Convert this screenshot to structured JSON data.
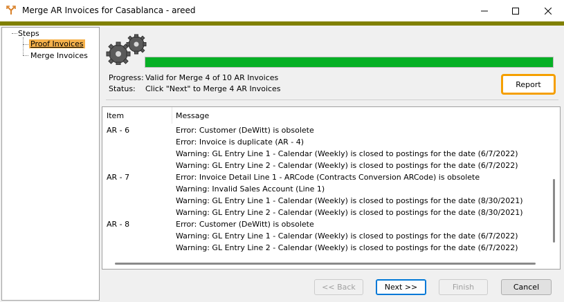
{
  "window": {
    "title": "Merge AR Invoices for Casablanca - areed",
    "icons": {
      "app": "merge-arrow-icon",
      "minimize": "minimize-icon",
      "maximize": "maximize-icon",
      "close": "close-icon"
    },
    "accent_bar_color": "#808000"
  },
  "tree": {
    "root_label": "Steps",
    "items": [
      {
        "label": "Proof Invoices",
        "selected": true
      },
      {
        "label": "Merge Invoices",
        "selected": false
      }
    ],
    "selected_color": "#f6b24b"
  },
  "progress": {
    "icon": "gears-icon",
    "fraction": 1.0,
    "bar_color": "#06b025",
    "progress_label": "Progress:",
    "progress_text": "Valid for Merge 4 of 10 AR Invoices",
    "status_label": "Status:",
    "status_text": "Click \"Next\" to Merge 4 AR Invoices"
  },
  "report_button": {
    "label": "Report",
    "highlight_color": "#f59f00"
  },
  "grid": {
    "columns": [
      "Item",
      "Message"
    ],
    "rows": [
      {
        "item": "AR - 6",
        "message": "Error: Customer (DeWitt) is obsolete"
      },
      {
        "item": "",
        "message": "Error: Invoice is duplicate (AR - 4)"
      },
      {
        "item": "",
        "message": "Warning: GL Entry Line 1 - Calendar (Weekly) is closed to postings for the date (6/7/2022)"
      },
      {
        "item": "",
        "message": "Warning: GL Entry Line 2 - Calendar (Weekly) is closed to postings for the date (6/7/2022)"
      },
      {
        "item": "AR - 7",
        "message": "Error: Invoice Detail Line 1 - ARCode (Contracts Conversion ARCode) is obsolete"
      },
      {
        "item": "",
        "message": "Warning: Invalid Sales Account (Line 1)"
      },
      {
        "item": "",
        "message": "Warning: GL Entry Line 1 - Calendar (Weekly) is closed to postings for the date (8/30/2021)"
      },
      {
        "item": "",
        "message": "Warning: GL Entry Line 2 - Calendar (Weekly) is closed to postings for the date (8/30/2021)"
      },
      {
        "item": "AR - 8",
        "message": "Error: Customer (DeWitt) is obsolete"
      },
      {
        "item": "",
        "message": "Warning: GL Entry Line 1 - Calendar (Weekly) is closed to postings for the date (6/7/2022)"
      },
      {
        "item": "",
        "message": "Warning: GL Entry Line 2 - Calendar (Weekly) is closed to postings for the date (6/7/2022)"
      }
    ]
  },
  "footer": {
    "back_label": "<< Back",
    "next_label": "Next >>",
    "finish_label": "Finish",
    "cancel_label": "Cancel"
  }
}
